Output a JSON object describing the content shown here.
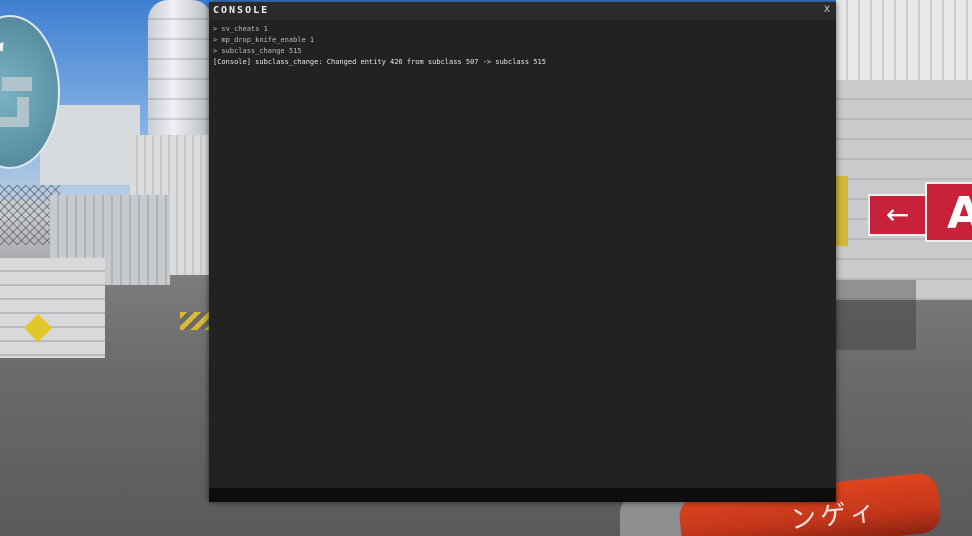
{
  "console": {
    "title": "CONSOLE",
    "close_label": "X",
    "log": [
      {
        "type": "command",
        "text": "> sv_cheats 1"
      },
      {
        "type": "command",
        "text": "> mp_drop_knife_enable 1"
      },
      {
        "type": "command",
        "text": "> subclass_change 515"
      },
      {
        "type": "output",
        "text": "[Console] subclass_change: Changed entity 426 from subclass 507 -> subclass 515"
      }
    ],
    "input_value": ""
  },
  "scene": {
    "sign_arrow_glyph": "←",
    "sign_letter": "A",
    "weapon_text": "ンゲィ"
  },
  "colors": {
    "console_bg": "#222222",
    "console_input_bg": "#0d0d0d",
    "sign_red": "#c8223a",
    "weapon_orange": "#e0451f"
  },
  "icons": {
    "radar_player": "player-arrow-icon"
  }
}
